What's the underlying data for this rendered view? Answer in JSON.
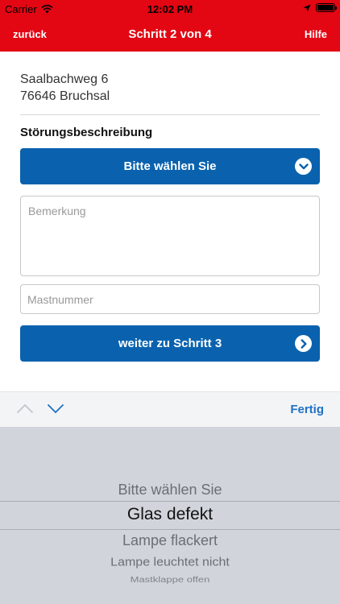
{
  "status_bar": {
    "carrier": "Carrier",
    "time": "12:02 PM"
  },
  "nav": {
    "back_label": "zurück",
    "title": "Schritt 2 von 4",
    "help_label": "Hilfe"
  },
  "address": {
    "street": "Saalbachweg 6",
    "city": "76646 Bruchsal"
  },
  "form": {
    "section_title": "Störungsbeschreibung",
    "select_label": "Bitte wählen Sie",
    "remark_placeholder": "Bemerkung",
    "mast_placeholder": "Mastnummer",
    "next_label": "weiter zu Schritt 3"
  },
  "toolbar": {
    "done_label": "Fertig"
  },
  "picker": {
    "options": [
      "Bitte wählen Sie",
      "Glas defekt",
      "Lampe flackert",
      "Lampe leuchtet nicht",
      "Mastklappe offen"
    ],
    "selected": "Glas defekt"
  },
  "colors": {
    "brand_red": "#e30613",
    "button_blue": "#0a62ae",
    "link_blue": "#1f71c4"
  }
}
